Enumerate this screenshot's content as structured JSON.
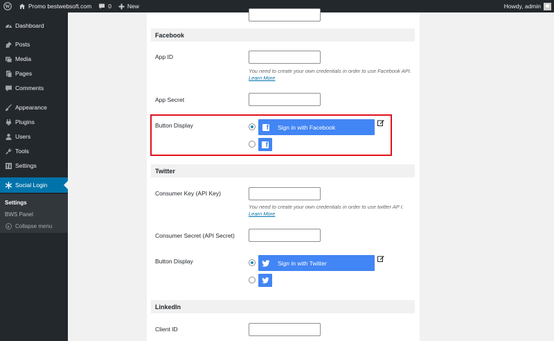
{
  "adminbar": {
    "site_name": "Promo bestwebsoft.com",
    "comments_count": "0",
    "new_label": "New",
    "howdy": "Howdy, admin"
  },
  "sidebar": {
    "items": [
      {
        "label": "Dashboard",
        "icon": "dashboard-icon"
      },
      {
        "label": "Posts",
        "icon": "pin-icon"
      },
      {
        "label": "Media",
        "icon": "media-icon"
      },
      {
        "label": "Pages",
        "icon": "pages-icon"
      },
      {
        "label": "Comments",
        "icon": "comments-icon"
      },
      {
        "label": "Appearance",
        "icon": "brush-icon"
      },
      {
        "label": "Plugins",
        "icon": "plug-icon"
      },
      {
        "label": "Users",
        "icon": "users-icon"
      },
      {
        "label": "Tools",
        "icon": "wrench-icon"
      },
      {
        "label": "Settings",
        "icon": "settings-icon"
      },
      {
        "label": "Social Login",
        "icon": "snowflake-icon"
      }
    ],
    "submenu": [
      "Settings",
      "BWS Panel"
    ],
    "collapse_label": "Collapse menu"
  },
  "sections": {
    "facebook": {
      "title": "Facebook",
      "app_id_label": "App ID",
      "desc": "You need to create your own credentials in order to use Facebook API.",
      "learn_more": "Learn More",
      "app_secret_label": "App Secret",
      "button_display_label": "Button Display",
      "button_text": "Sign in with Facebook"
    },
    "twitter": {
      "title": "Twitter",
      "consumer_key_label": "Consumer Key (API Key)",
      "desc": "You need to create your own credentials in order to use twitter AP I.",
      "learn_more": "Learn More",
      "consumer_secret_label": "Consumer Secret (API Secret)",
      "button_display_label": "Button Display",
      "button_text": "Sign in with Twitter"
    },
    "linkedin": {
      "title": "LinkedIn",
      "client_id_label": "Client ID"
    }
  },
  "colors": {
    "accent": "#0073aa",
    "button": "#4285f4",
    "highlight": "#e0101c"
  }
}
